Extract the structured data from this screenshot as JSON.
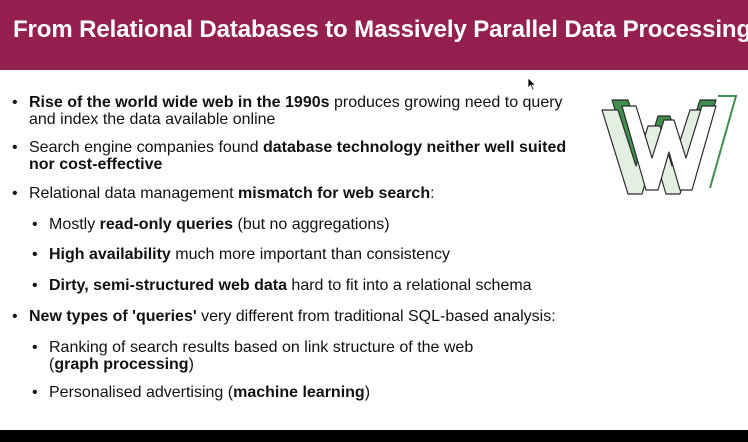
{
  "slide": {
    "title": "From Relational Databases to Massively Parallel Data Processing"
  },
  "bullets": [
    {
      "b1_bold": "Rise of the world wide web in the 1990s",
      "b1_rest": " produces growing need to query",
      "b1_line2": "and index the data available online"
    },
    {
      "b2_plain": "Search engine companies found ",
      "b2_bold1": "database technology neither well suited",
      "b2_bold2": "nor cost-effective"
    },
    {
      "b3_plain": "Relational data management ",
      "b3_bold": "mismatch for web search",
      "b3_tail": ":"
    },
    {
      "s1_plain": "Mostly ",
      "s1_bold": "read-only queries",
      "s1_tail": " (but no aggregations)"
    },
    {
      "s2_bold": "High availability",
      "s2_tail": " much more important than consistency"
    },
    {
      "s3_bold": "Dirty, semi-structured web data",
      "s3_tail": " hard to fit into a relational schema"
    },
    {
      "b4_bold": "New types of 'queries'",
      "b4_tail": " very different from traditional SQL-based analysis:"
    },
    {
      "s4_line1": "Ranking of search results based on link structure of the web",
      "s4_open": "(",
      "s4_bold": "graph processing",
      "s4_close": ")"
    },
    {
      "s5_plain": "Personalised advertising (",
      "s5_bold": "machine learning",
      "s5_close": ")"
    }
  ],
  "glyphs": {
    "bullet": "•"
  },
  "colors": {
    "title_bar": "#94204f",
    "logo_green": "#3f8f4f",
    "logo_light": "#e3efe1"
  },
  "icons": {
    "logo": "www-logo-icon",
    "cursor": "mouse-cursor-icon"
  }
}
